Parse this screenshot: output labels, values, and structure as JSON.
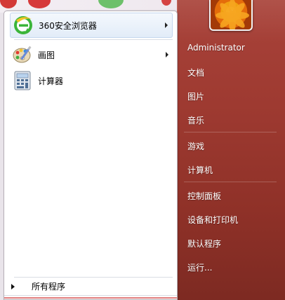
{
  "start_menu": {
    "programs": [
      {
        "label": "360安全浏览器",
        "icon": "360-browser-icon",
        "has_submenu": true
      },
      {
        "label": "画图",
        "icon": "paint-icon",
        "has_submenu": true
      },
      {
        "label": "计算器",
        "icon": "calculator-icon",
        "has_submenu": false
      }
    ],
    "all_programs_label": "所有程序",
    "right_items": [
      "Administrator",
      "文档",
      "图片",
      "音乐",
      "游戏",
      "计算机",
      "控制面板",
      "设备和打印机",
      "默认程序",
      "运行..."
    ]
  },
  "colors": {
    "right_panel": "#9e3a31",
    "left_panel": "#ffffff",
    "highlight": "#e2ecf8"
  }
}
